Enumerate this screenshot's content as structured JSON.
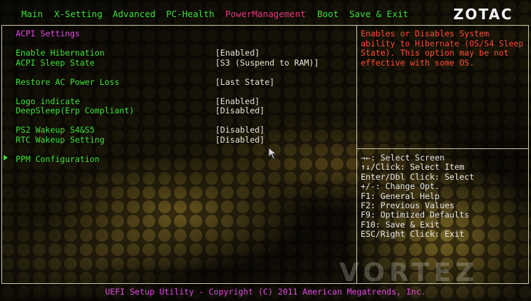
{
  "logo": "ZOTAC",
  "tabs": [
    {
      "label": "Main",
      "active": false
    },
    {
      "label": "X-Setting",
      "active": false
    },
    {
      "label": "Advanced",
      "active": false
    },
    {
      "label": "PC-Health",
      "active": false
    },
    {
      "label": "PowerManagement",
      "active": true
    },
    {
      "label": "Boot",
      "active": false
    },
    {
      "label": "Save & Exit",
      "active": false
    }
  ],
  "section_title": "ACPI Settings",
  "settings": [
    {
      "label": "Enable Hibernation",
      "value": "[Enabled]"
    },
    {
      "label": "ACPI Sleep State",
      "value": "[S3 (Suspend to RAM)]"
    },
    {
      "label": "Restore AC Power Loss",
      "value": "[Last State]"
    },
    {
      "label": "Logo indicate",
      "value": "[Enabled]"
    },
    {
      "label": "DeepSleep(Erp Compliant)",
      "value": "[Disabled]"
    },
    {
      "label": "PS2 Wakeup S4&S5",
      "value": "[Disabled]"
    },
    {
      "label": "RTC Wakeup Setting",
      "value": "[Disabled]"
    }
  ],
  "submenu": {
    "label": "PPM Configuration"
  },
  "help_text": "Enables or Disables System ability to Hibernate (OS/S4 Sleep State). This option may be not effective with some OS.",
  "key_help": [
    "→←: Select Screen",
    "↑↓/Click: Select Item",
    "Enter/Dbl Click: Select",
    "+/-: Change Opt.",
    "F1: General Help",
    "F2: Previous Values",
    "F9: Optimized Defaults",
    "F10: Save & Exit",
    "ESC/Right Click: Exit"
  ],
  "footer": "UEFI Setup Utility - Copyright (C) 2011 American Megatrends, Inc.",
  "watermark": "VORTEZ",
  "colors": {
    "menu_text": "#3ee03e",
    "active_tab": "#e43a7a",
    "section_title": "#e048e0",
    "help_text": "#ff4b3a",
    "value_text": "#e6e6d8",
    "frame": "#c9c9a8"
  }
}
